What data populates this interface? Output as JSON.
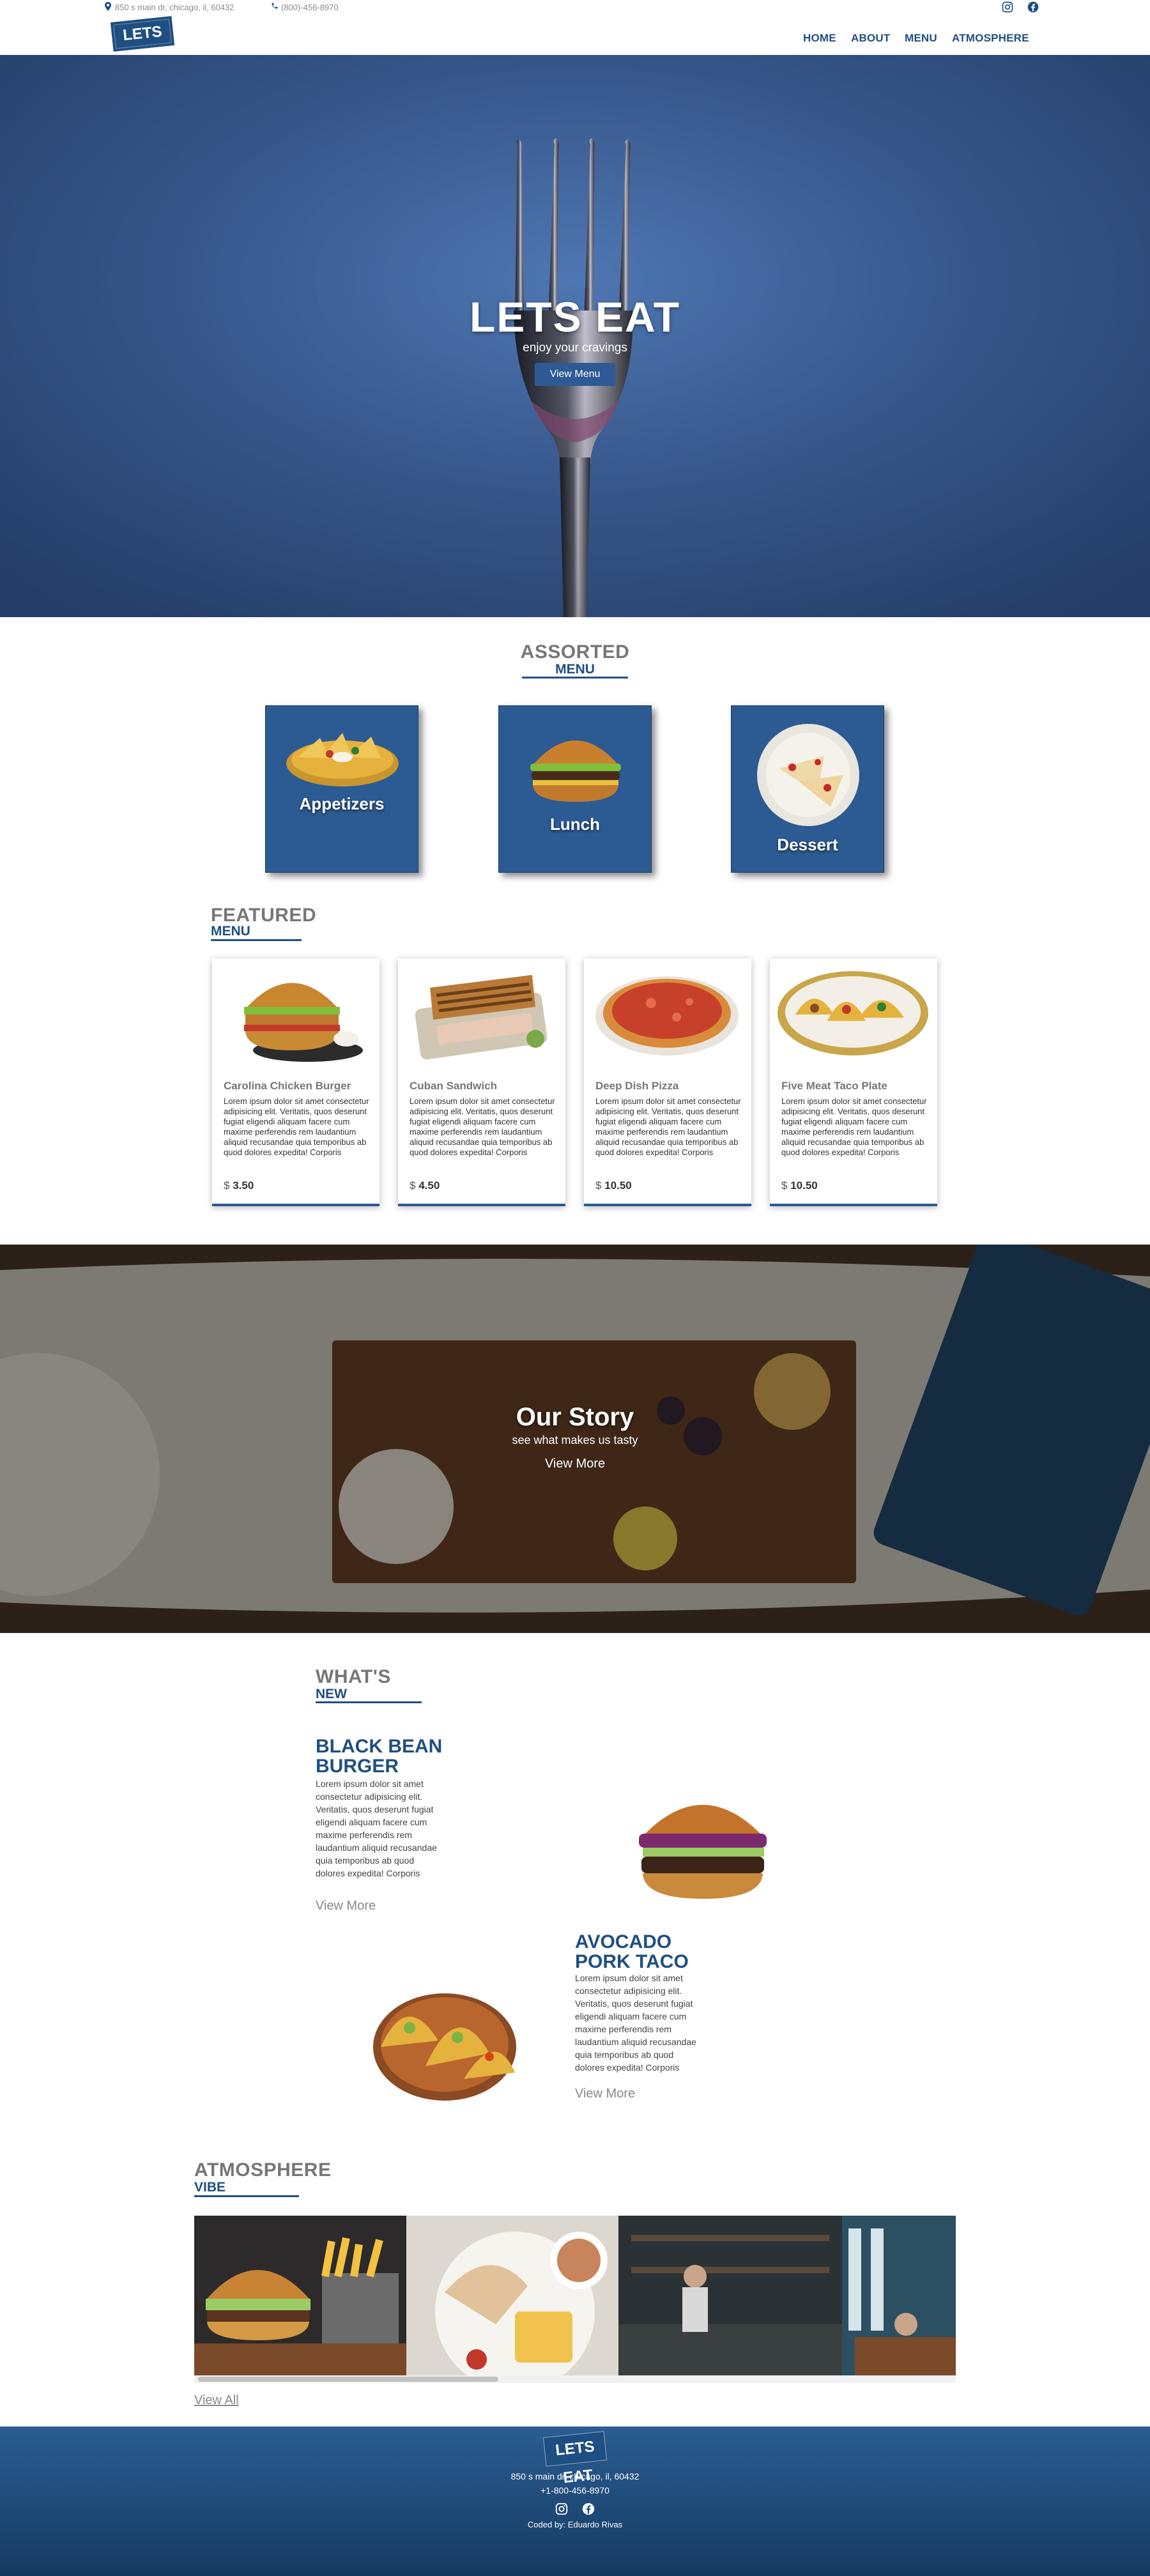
{
  "topbar": {
    "address": "850 s main dr, chicago, il, 60432",
    "phone": "(800)-456-8970",
    "icons": [
      "map-pin-icon",
      "phone-icon",
      "instagram-icon",
      "facebook-icon"
    ]
  },
  "nav": {
    "logo_text": "LETS EAT",
    "links": [
      "HOME",
      "ABOUT",
      "MENU",
      "ATMOSPHERE"
    ]
  },
  "hero": {
    "title": "LETS EAT",
    "subtitle": "enjoy your cravings",
    "button": "View Menu"
  },
  "assorted": {
    "heading": "ASSORTED",
    "subheading": "MENU",
    "categories": [
      "Appetizers",
      "Lunch",
      "Dessert"
    ]
  },
  "featured": {
    "heading": "FEATURED",
    "subheading": "MENU",
    "items": [
      {
        "name": "Carolina Chicken Burger",
        "desc": "Lorem ipsum dolor sit amet consectetur adipisicing elit. Veritatis, quos deserunt fugiat eligendi aliquam facere cum maxime perferendis rem laudantium aliquid recusandae quia temporibus ab quod dolores expedita! Corporis",
        "currency": "$",
        "price": "3.50"
      },
      {
        "name": "Cuban Sandwich",
        "desc": "Lorem ipsum dolor sit amet consectetur adipisicing elit. Veritatis, quos deserunt fugiat eligendi aliquam facere cum maxime perferendis rem laudantium aliquid recusandae quia temporibus ab quod dolores expedita! Corporis",
        "currency": "$",
        "price": "4.50"
      },
      {
        "name": "Deep Dish Pizza",
        "desc": "Lorem ipsum dolor sit amet consectetur adipisicing elit. Veritatis, quos deserunt fugiat eligendi aliquam facere cum maxime perferendis rem laudantium aliquid recusandae quia temporibus ab quod dolores expedita! Corporis",
        "currency": "$",
        "price": "10.50"
      },
      {
        "name": "Five Meat Taco Plate",
        "desc": "Lorem ipsum dolor sit amet consectetur adipisicing elit. Veritatis, quos deserunt fugiat eligendi aliquam facere cum maxime perferendis rem laudantium aliquid recusandae quia temporibus ab quod dolores expedita! Corporis",
        "currency": "$",
        "price": "10.50"
      }
    ]
  },
  "story": {
    "title": "Our Story",
    "subtitle": "see what makes us tasty",
    "button": "View More"
  },
  "whats_new": {
    "heading": "WHAT'S",
    "subheading": "NEW",
    "items": [
      {
        "title_line1": "BLACK BEAN",
        "title_line2": "BURGER",
        "desc": "Lorem ipsum dolor sit amet consectetur adipisicing elit. Veritatis, quos deserunt fugiat eligendi aliquam facere cum maxime perferendis rem laudantium aliquid recusandae quia temporibus ab quod dolores expedita! Corporis",
        "more": "View More"
      },
      {
        "title_line1": "AVOCADO",
        "title_line2": "PORK TACO",
        "desc": "Lorem ipsum dolor sit amet consectetur adipisicing elit. Veritatis, quos deserunt fugiat eligendi aliquam facere cum maxime perferendis rem laudantium aliquid recusandae quia temporibus ab quod dolores expedita! Corporis",
        "more": "View More"
      }
    ]
  },
  "atmosphere": {
    "heading": "ATMOSPHERE",
    "subheading": "VIBE",
    "view_all": "View All"
  },
  "footer": {
    "logo_text": "LETS EAT",
    "address": "850 s main dr, chicago, il, 60432",
    "phone": "+1-800-456-8970",
    "credit": "Coded by: Eduardo Rivas"
  },
  "colors": {
    "brand_blue": "#1f4f82",
    "card_blue": "#2c5a92",
    "hero_blue": "#3f64a0",
    "gray_text": "#777777"
  }
}
